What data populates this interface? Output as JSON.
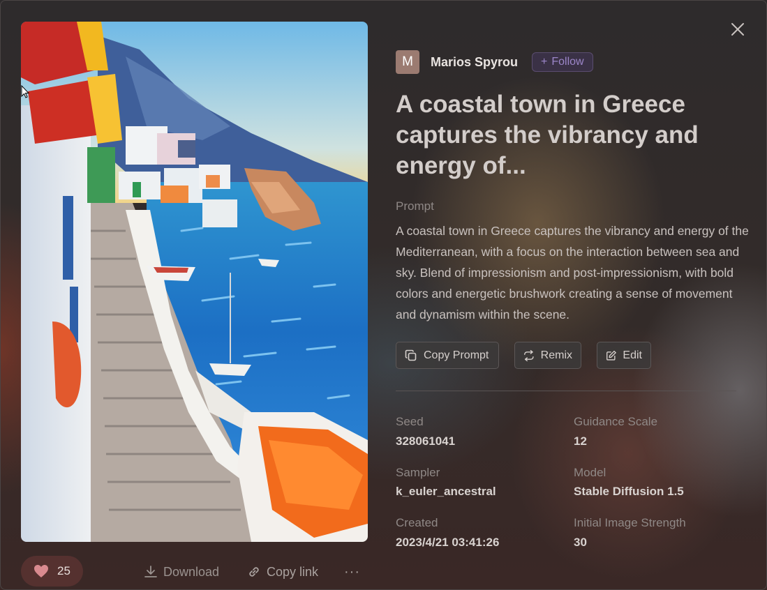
{
  "author": {
    "avatar_letter": "M",
    "name": "Marios Spyrou",
    "follow_label": "Follow"
  },
  "title": "A coastal town in Greece captures the vibrancy and energy of...",
  "prompt": {
    "label": "Prompt",
    "text": "A coastal town in Greece captures the vibrancy and energy of the Mediterranean, with a focus on the interaction between sea and sky. Blend of impressionism and post-impressionism, with bold colors and energetic brushwork creating a sense of movement and dynamism within the scene."
  },
  "actions": {
    "copy_prompt": "Copy Prompt",
    "remix": "Remix",
    "edit": "Edit"
  },
  "meta": {
    "seed_label": "Seed",
    "seed_value": "328061041",
    "guidance_label": "Guidance Scale",
    "guidance_value": "12",
    "sampler_label": "Sampler",
    "sampler_value": "k_euler_ancestral",
    "model_label": "Model",
    "model_value": "Stable Diffusion 1.5",
    "created_label": "Created",
    "created_value": "2023/4/21 03:41:26",
    "strength_label": "Initial Image Strength",
    "strength_value": "30"
  },
  "bottom_bar": {
    "like_count": "25",
    "download_label": "Download",
    "copy_link_label": "Copy link",
    "more_label": "···"
  },
  "colors": {
    "accent_follow": "#9c86c9",
    "heart": "#d98a8f"
  }
}
